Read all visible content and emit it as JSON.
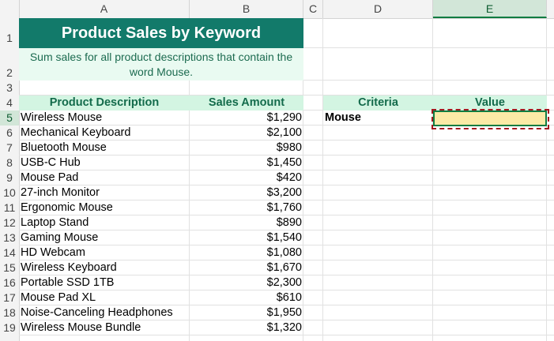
{
  "columns": [
    "A",
    "B",
    "C",
    "D",
    "E"
  ],
  "selected_column": "E",
  "row_numbers": [
    "1",
    "2",
    "3",
    "4",
    "5",
    "6",
    "7",
    "8",
    "9",
    "10",
    "11",
    "12",
    "13",
    "14",
    "15",
    "16",
    "17",
    "18",
    "19"
  ],
  "sheet": {
    "title": "Product Sales by Keyword",
    "subtitle": "Sum sales for all product descriptions that contain the word Mouse.",
    "headers": {
      "product_description": "Product Description",
      "sales_amount": "Sales Amount",
      "criteria": "Criteria",
      "value": "Value"
    },
    "criteria_value": "Mouse",
    "result_value": "",
    "rows": [
      {
        "product": "Wireless Mouse",
        "sales": "$1,290"
      },
      {
        "product": "Mechanical Keyboard",
        "sales": "$2,100"
      },
      {
        "product": "Bluetooth Mouse",
        "sales": "$980"
      },
      {
        "product": "USB-C Hub",
        "sales": "$1,450"
      },
      {
        "product": "Mouse Pad",
        "sales": "$420"
      },
      {
        "product": "27-inch Monitor",
        "sales": "$3,200"
      },
      {
        "product": "Ergonomic Mouse",
        "sales": "$1,760"
      },
      {
        "product": "Laptop Stand",
        "sales": "$890"
      },
      {
        "product": "Gaming Mouse",
        "sales": "$1,540"
      },
      {
        "product": "HD Webcam",
        "sales": "$1,080"
      },
      {
        "product": "Wireless Keyboard",
        "sales": "$1,670"
      },
      {
        "product": "Portable SSD 1TB",
        "sales": "$2,300"
      },
      {
        "product": "Mouse Pad XL",
        "sales": "$610"
      },
      {
        "product": "Noise-Canceling Headphones",
        "sales": "$1,950"
      },
      {
        "product": "Wireless Mouse Bundle",
        "sales": "$1,320"
      }
    ]
  },
  "colors": {
    "title_bg": "#127a6a",
    "header_bg": "#d3f5e2",
    "subtitle_bg": "#e9faf1",
    "active_cell_bg": "#fbeaa6",
    "selection_green": "#107c41",
    "copy_marquee": "#a3191f"
  }
}
